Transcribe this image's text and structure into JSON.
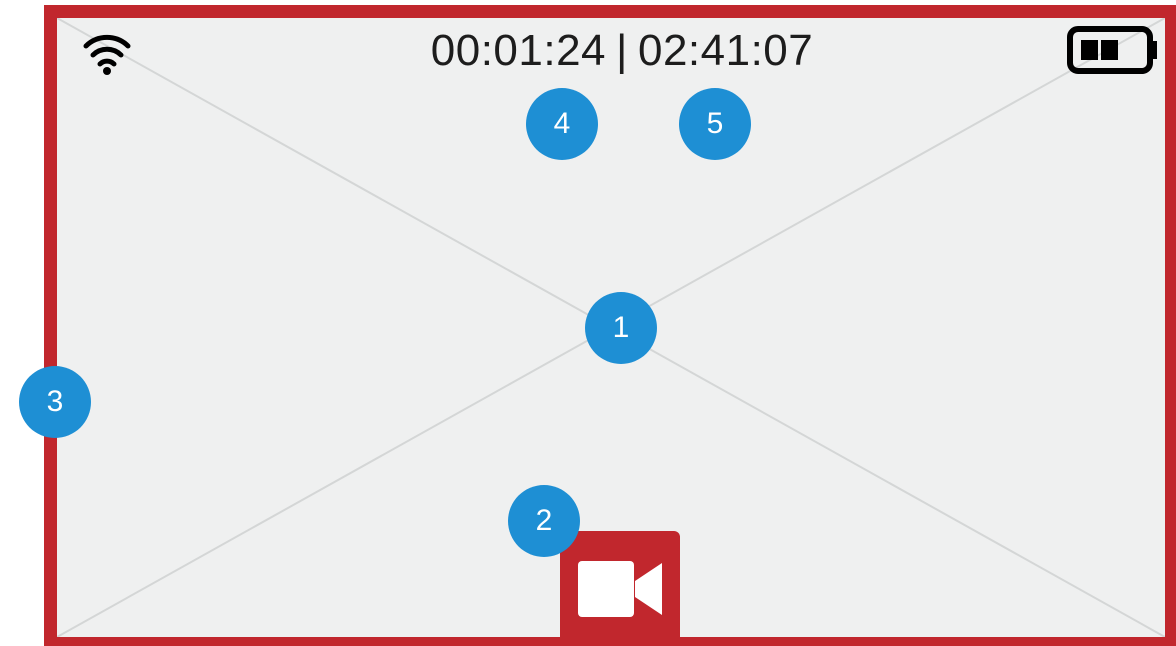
{
  "status_bar": {
    "elapsed_time": "00:01:24",
    "separator": "|",
    "total_time": "02:41:07",
    "wifi_icon": "wifi-icon",
    "battery_icon": "battery-icon",
    "battery_level": 0.66
  },
  "viewfinder": {
    "placeholder_icon": "image-placeholder-icon",
    "background_color": "#eff0f0",
    "border_color": "#c1272d"
  },
  "record_button": {
    "icon": "video-camera-icon",
    "color": "#c1272d"
  },
  "callouts": {
    "viewfinder": "1",
    "record_button": "2",
    "frame_border": "3",
    "elapsed_time": "4",
    "total_time": "5",
    "color": "#1e8fd4"
  }
}
